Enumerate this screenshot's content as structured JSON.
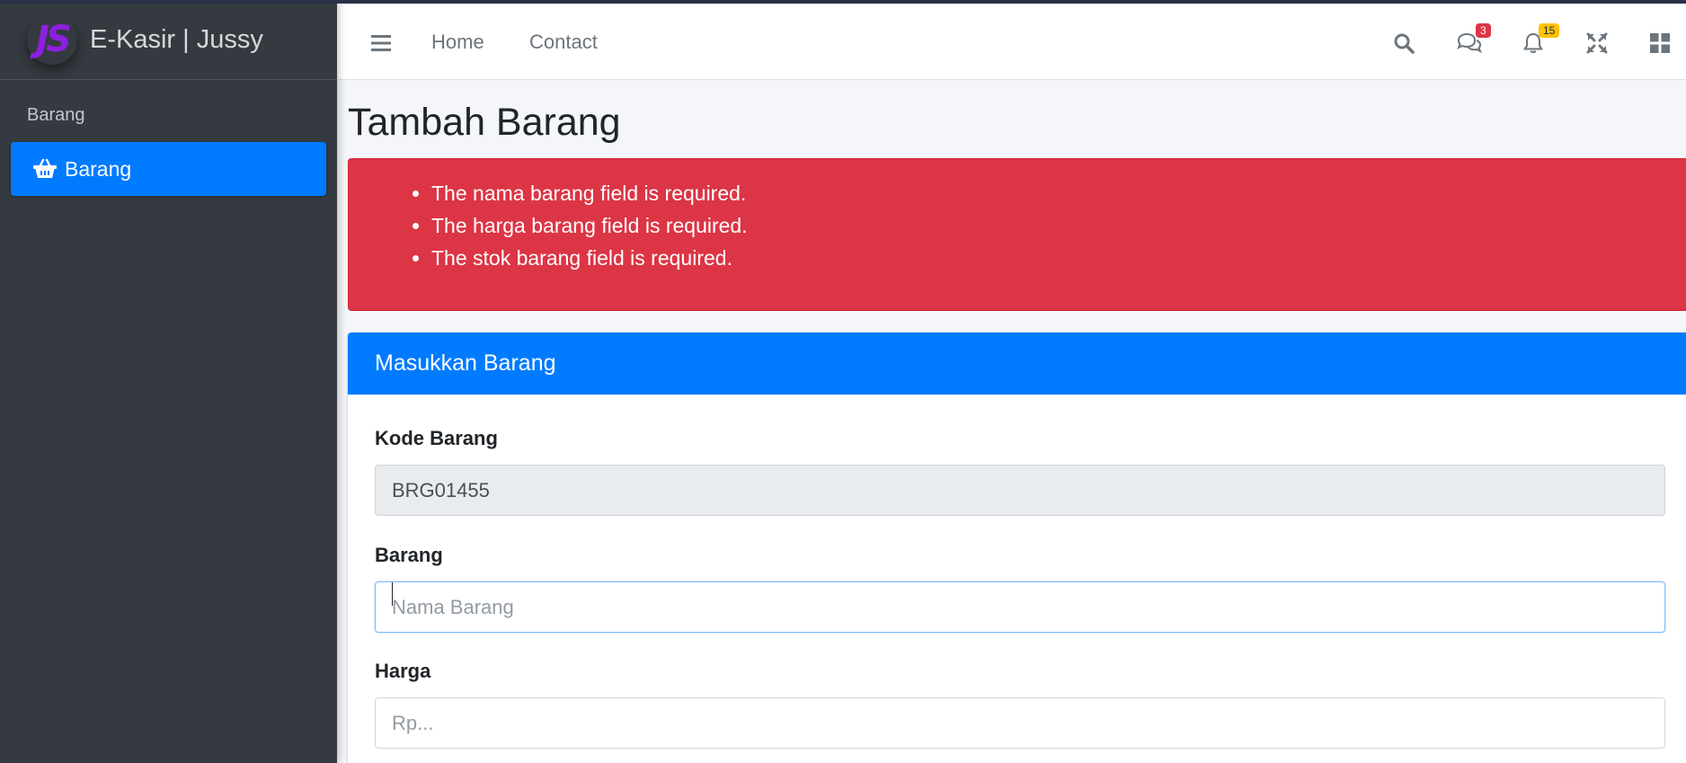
{
  "brand": {
    "logo_text": "JS",
    "name": "E-Kasir | Jussy"
  },
  "sidebar": {
    "header": "Barang",
    "items": [
      {
        "label": "Barang",
        "icon": "shopping-basket-icon"
      }
    ]
  },
  "navbar": {
    "links": [
      {
        "label": "Home"
      },
      {
        "label": "Contact"
      }
    ],
    "messages_count": "3",
    "notifications_count": "15"
  },
  "page": {
    "title": "Tambah Barang"
  },
  "alert": {
    "errors": [
      "The nama barang field is required.",
      "The harga barang field is required.",
      "The stok barang field is required."
    ]
  },
  "form": {
    "title": "Masukkan Barang",
    "kode": {
      "label": "Kode Barang",
      "value": "BRG01455"
    },
    "barang": {
      "label": "Barang",
      "placeholder": "Nama Barang"
    },
    "harga": {
      "label": "Harga",
      "placeholder": "Rp..."
    }
  },
  "colors": {
    "primary": "#007bff",
    "danger": "#dc3545",
    "sidebar": "#343a40",
    "logo": "#8e1fe0",
    "warning": "#ffc107"
  }
}
